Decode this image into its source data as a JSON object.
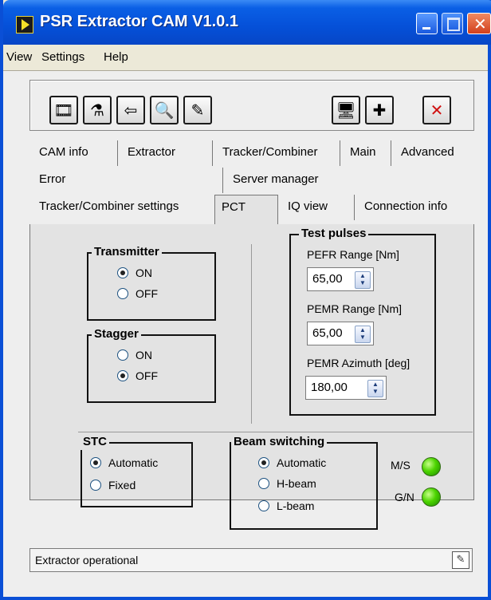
{
  "window": {
    "title": "PSR Extractor CAM  V1.0.1"
  },
  "menu": [
    {
      "label": "View"
    },
    {
      "label": "Settings"
    },
    {
      "label": "Help"
    }
  ],
  "toolbar": {
    "icons": [
      "film-icon",
      "wizard-icon",
      "import-icon",
      "search-icon",
      "edit-icon",
      "monitor-icon",
      "plugin-icon",
      "close-icon"
    ]
  },
  "tabs": {
    "row1": [
      "CAM info",
      "Extractor",
      "Tracker/Combiner",
      "Main",
      "Advanced"
    ],
    "row2": [
      "Error",
      "Server manager"
    ],
    "row3": [
      "Tracker/Combiner settings",
      "PCT",
      "IQ view",
      "Connection info"
    ],
    "selected": "PCT"
  },
  "transmitter": {
    "title": "Transmitter",
    "on": "ON",
    "off": "OFF",
    "selected": "ON"
  },
  "stagger": {
    "title": "Stagger",
    "on": "ON",
    "off": "OFF",
    "selected": "OFF"
  },
  "test_pulses": {
    "title": "Test pulses",
    "pefr_label": "PEFR Range [Nm]",
    "pefr_value": "65,00",
    "pemr_label": "PEMR Range [Nm]",
    "pemr_value": "65,00",
    "azimuth_label": "PEMR Azimuth [deg]",
    "azimuth_value": "180,00"
  },
  "stc": {
    "title": "STC",
    "automatic": "Automatic",
    "fixed": "Fixed",
    "selected": "Automatic"
  },
  "beam": {
    "title": "Beam switching",
    "automatic": "Automatic",
    "h": "H-beam",
    "l": "L-beam",
    "selected": "Automatic"
  },
  "indicators": {
    "ms": "M/S",
    "gn": "G/N",
    "ms_color": "#4cd400",
    "gn_color": "#4cd400"
  },
  "status": {
    "text": "Extractor operational"
  }
}
